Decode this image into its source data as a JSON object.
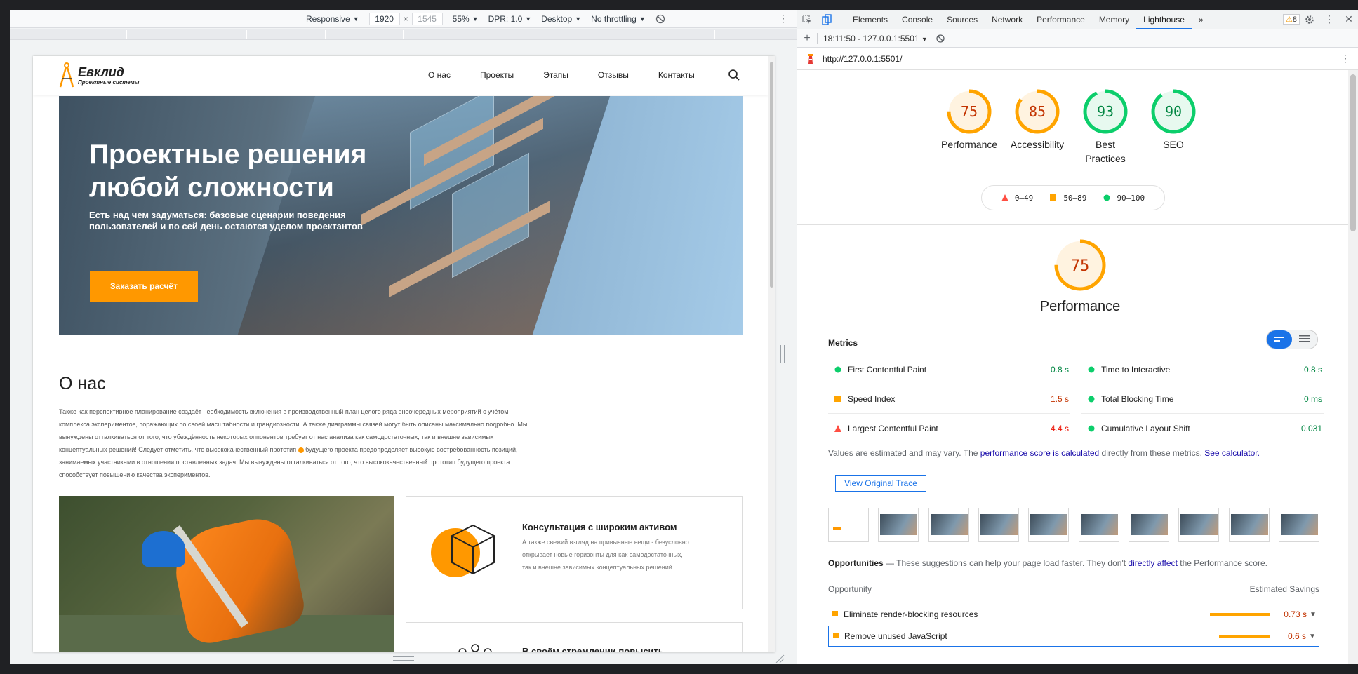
{
  "device_toolbar": {
    "device": "Responsive",
    "width": "1920",
    "height": "1545",
    "zoom": "55%",
    "dpr": "DPR: 1.0",
    "mode": "Desktop",
    "throttling": "No throttling"
  },
  "site": {
    "logo_title": "Евклид",
    "logo_sub": "Проектные системы",
    "nav": [
      "О нас",
      "Проекты",
      "Этапы",
      "Отзывы",
      "Контакты"
    ],
    "hero_title": "Проектные решения любой сложности",
    "hero_sub": "Есть над чем задуматься: базовые сценарии поведения пользователей и по сей день остаются уделом проектантов",
    "hero_cta": "Заказать расчёт",
    "about_title": "О нас",
    "about_text_1": "Также как перспективное планирование создаёт необходимость включения в производственный план целого ряда внеочередных мероприятий с учётом комплекса экспериментов, поражающих по своей масштабности и грандиозности. А также диаграммы связей могут быть описаны максимально подробно. Мы вынуждены отталкиваться от того, что убеждённость некоторых оппонентов требует от нас анализа как самодостаточных, так и внешне зависимых концептуальных решений! Следует отметить, что высококачественный прототип",
    "about_text_2": "будущего проекта предопределяет высокую востребованность позиций, занимаемых участниками в отношении поставленных задач. Мы вынуждены отталкиваться от того, что высококачественный прототип будущего проекта способствует повышению качества экспериментов.",
    "card1_title": "Консультация с широким активом",
    "card1_text": "А также свежий взгляд на привычные вещи - безусловно открывает новые горизонты для как самодостаточных, так и внешне зависимых концептуальных решений.",
    "card2_title": "В своём стремлении повысить"
  },
  "devtools": {
    "tabs": [
      "Elements",
      "Console",
      "Sources",
      "Network",
      "Performance",
      "Memory",
      "Lighthouse"
    ],
    "active_tab": "Lighthouse",
    "more": "»",
    "warnings": "8",
    "report_label": "18:11:50 - 127.0.0.1:5501",
    "url": "http://127.0.0.1:5501/"
  },
  "lighthouse": {
    "gauges": [
      {
        "score": "75",
        "label": "Performance",
        "color": "#ffa400"
      },
      {
        "score": "85",
        "label": "Accessibility",
        "color": "#ffa400"
      },
      {
        "score": "93",
        "label": "Best Practices",
        "color": "#0cce6b"
      },
      {
        "score": "90",
        "label": "SEO",
        "color": "#0cce6b"
      }
    ],
    "legend": [
      "0–49",
      "50–89",
      "90–100"
    ],
    "perf_score": "75",
    "perf_title": "Performance",
    "metrics_title": "Metrics",
    "metrics": [
      {
        "label": "First Contentful Paint",
        "value": "0.8 s",
        "status": "pass"
      },
      {
        "label": "Time to Interactive",
        "value": "0.8 s",
        "status": "pass"
      },
      {
        "label": "Speed Index",
        "value": "1.5 s",
        "status": "average"
      },
      {
        "label": "Total Blocking Time",
        "value": "0 ms",
        "status": "pass"
      },
      {
        "label": "Largest Contentful Paint",
        "value": "4.4 s",
        "status": "fail"
      },
      {
        "label": "Cumulative Layout Shift",
        "value": "0.031",
        "status": "pass"
      }
    ],
    "note_pre": "Values are estimated and may vary. The ",
    "note_link1": "performance score is calculated",
    "note_mid": " directly from these metrics. ",
    "note_link2": "See calculator.",
    "view_trace": "View Original Trace",
    "opp_title": "Opportunities",
    "opp_desc_pre": " — These suggestions can help your page load faster. They don't ",
    "opp_desc_link": "directly affect",
    "opp_desc_post": " the Performance score.",
    "opp_col1": "Opportunity",
    "opp_col2": "Estimated Savings",
    "opportunities": [
      {
        "label": "Eliminate render-blocking resources",
        "value": "0.73 s"
      },
      {
        "label": "Remove unused JavaScript",
        "value": "0.6 s"
      }
    ]
  },
  "colors": {
    "pass": "#0cce6b",
    "average": "#ffa400",
    "fail": "#ff4e42",
    "accent": "#1a73e8",
    "brand": "#ff9800"
  }
}
